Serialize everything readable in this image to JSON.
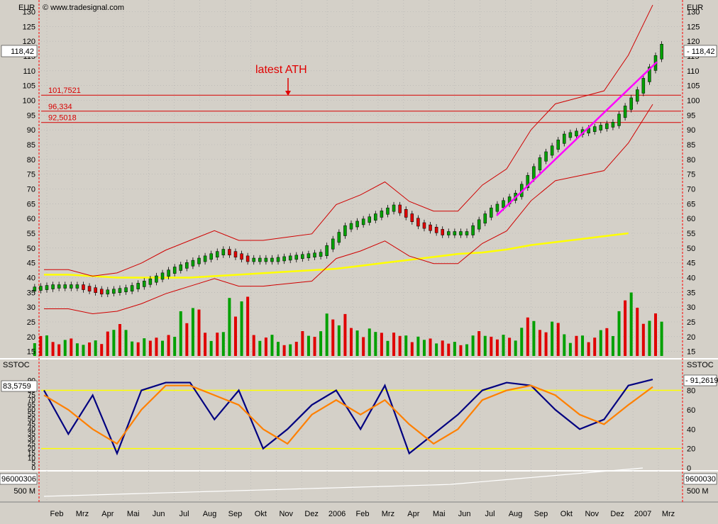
{
  "watermark": "© www.tradesignal.com",
  "currency_label": "EUR",
  "colors": {
    "background": "#d4d0c8",
    "grid": "#b0b0b0",
    "ref_lines": "#d80000",
    "sma": "#ffff00",
    "trend": "#ff00ff",
    "up": "#00a000",
    "down": "#e00000",
    "stoch_fast": "#000080",
    "stoch_slow": "#ff8000"
  },
  "price_panel": {
    "last_price_label": "118,42",
    "annotation": "latest ATH",
    "ref_levels": [
      {
        "label": "101,7521",
        "value": 101.7521
      },
      {
        "label": "96,334",
        "value": 96.334
      },
      {
        "label": "92,5018",
        "value": 92.5018
      }
    ],
    "y_ticks": [
      "130",
      "125",
      "120",
      "115",
      "110",
      "105",
      "100",
      "95",
      "90",
      "85",
      "80",
      "75",
      "70",
      "65",
      "60",
      "55",
      "50",
      "45",
      "40",
      "35",
      "30",
      "25",
      "20",
      "15"
    ]
  },
  "stoch_panel": {
    "title": "SSTOC",
    "left_value_label": "83,5759",
    "right_value_label": "91,2619",
    "left_ticks": [
      "90",
      "85",
      "80",
      "75",
      "70",
      "65",
      "60",
      "55",
      "50",
      "45",
      "40",
      "35",
      "30",
      "25",
      "20",
      "15",
      "10",
      "5",
      "0"
    ],
    "right_ticks": [
      "80",
      "60",
      "40",
      "20",
      "0"
    ]
  },
  "volume_sum_panel": {
    "left_value_label": "96000306",
    "right_value_label": "9600030",
    "tick_label": "500 M"
  },
  "x_axis": {
    "labels": [
      "Feb",
      "Mrz",
      "Apr",
      "Mai",
      "Jun",
      "Jul",
      "Aug",
      "Sep",
      "Okt",
      "Nov",
      "Dez",
      "2006",
      "Feb",
      "Mrz",
      "Apr",
      "Mai",
      "Jun",
      "Jul",
      "Aug",
      "Sep",
      "Okt",
      "Nov",
      "Dez",
      "2007",
      "Mrz"
    ]
  },
  "chart_data": [
    {
      "type": "candlestick",
      "title": "",
      "ylabel": "EUR",
      "ylim": [
        13,
        133
      ],
      "x": [
        "Feb 05",
        "Mrz 05",
        "Apr 05",
        "Mai 05",
        "Jun 05",
        "Jul 05",
        "Aug 05",
        "Sep 05",
        "Okt 05",
        "Nov 05",
        "Dez 05",
        "Jan 06",
        "Feb 06",
        "Mrz 06",
        "Apr 06",
        "Mai 06",
        "Jun 06",
        "Jul 06",
        "Aug 06",
        "Sep 06",
        "Okt 06",
        "Nov 06",
        "Dez 06",
        "Jan 07",
        "Feb 07",
        "Mrz 07"
      ],
      "series": [
        {
          "name": "",
          "values": [
            37,
            37,
            35,
            36,
            39,
            43,
            46,
            49,
            46,
            46,
            47,
            48,
            57,
            60,
            64,
            58,
            55,
            55,
            63,
            68,
            80,
            88,
            90,
            92,
            103,
            118.42
          ]
        }
      ],
      "horizontal_lines": [
        101.7521,
        96.334,
        92.5018
      ],
      "grid": true
    },
    {
      "type": "bar",
      "title": "",
      "description": "Volume bars",
      "values_relative": [
        0.3,
        0.25,
        0.22,
        0.45,
        0.25,
        0.3,
        0.7,
        0.35,
        0.85,
        0.3,
        0.2,
        0.35,
        0.6,
        0.4,
        0.35,
        0.3,
        0.25,
        0.2,
        0.35,
        0.3,
        0.55,
        0.5,
        0.3,
        0.4,
        0.9,
        0.6
      ]
    },
    {
      "type": "line",
      "title": "SSTOC",
      "ylim": [
        0,
        95
      ],
      "horizontal_lines": [
        80,
        20
      ],
      "series": [
        {
          "name": "",
          "values": [
            80,
            35,
            75,
            15,
            80,
            88,
            88,
            50,
            80,
            20,
            40,
            65,
            80,
            40,
            85,
            15,
            35,
            55,
            80,
            88,
            85,
            60,
            40,
            50,
            85,
            91.26
          ]
        },
        {
          "name": "",
          "values": [
            75,
            60,
            40,
            25,
            60,
            85,
            85,
            75,
            65,
            40,
            25,
            55,
            70,
            55,
            70,
            45,
            25,
            40,
            70,
            80,
            85,
            75,
            55,
            45,
            65,
            83.58
          ]
        }
      ]
    }
  ]
}
